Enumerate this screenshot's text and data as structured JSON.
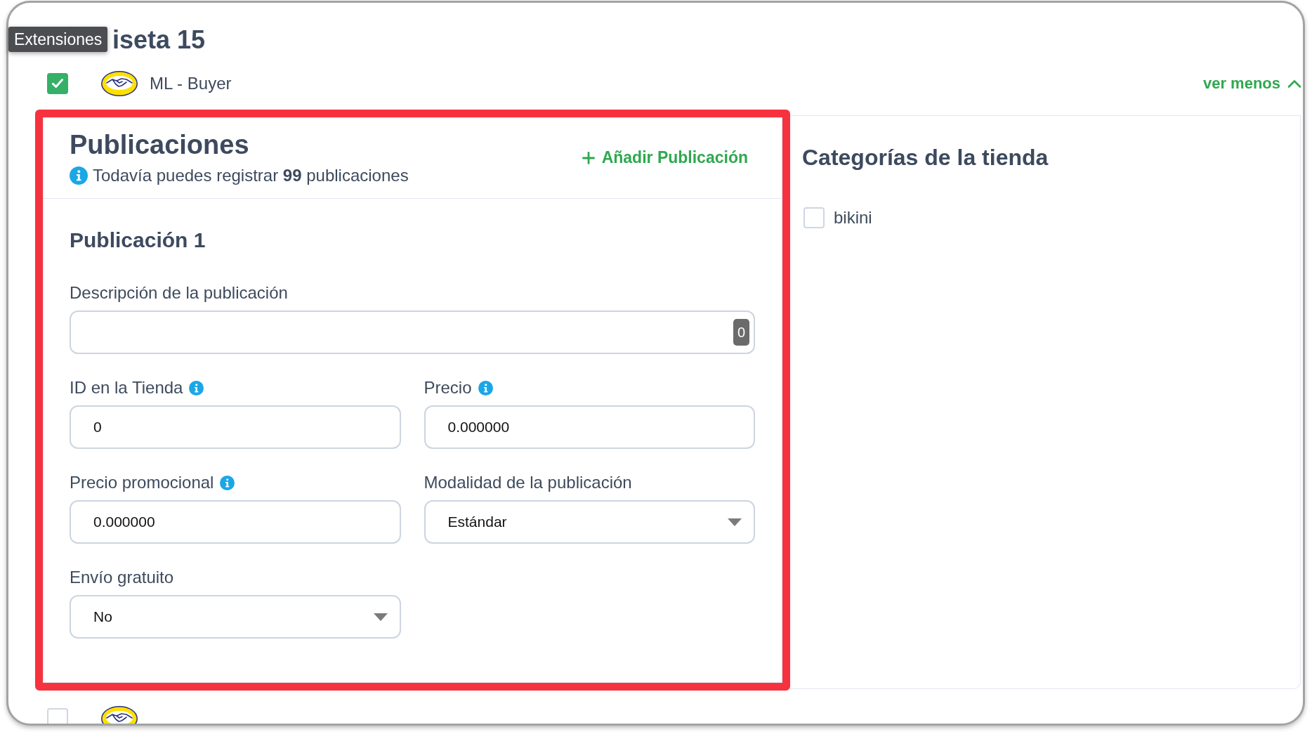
{
  "tooltip": {
    "text": "Extensiones"
  },
  "header": {
    "title": "iseta 15"
  },
  "extensions": [
    {
      "name": "ML - Buyer",
      "checked": true,
      "toggle": {
        "label": "ver menos",
        "expanded": true
      }
    },
    {
      "checked": false
    }
  ],
  "publications_panel": {
    "highlighted": true,
    "title": "Publicaciones",
    "info": "Todavía puedes registrar **99** publicaciones",
    "add_button": "Añadir Publicación",
    "publication": {
      "title": "Publicación 1",
      "fields": [
        {
          "kind": "counter_text",
          "label": "Descripción de la publicación",
          "info": false,
          "counter": "0"
        },
        {
          "kind": "text",
          "label": "ID en la Tienda",
          "info": true,
          "value": "0"
        },
        {
          "kind": "text",
          "label": "Precio",
          "info": true,
          "value": "0.000000"
        },
        {
          "kind": "text",
          "label": "Precio promocional",
          "info": true,
          "value": "0.000000"
        },
        {
          "kind": "select",
          "label": "Modalidad de la publicación",
          "info": false,
          "value": "Estándar"
        },
        {
          "kind": "select",
          "label": "Envío gratuito",
          "info": false,
          "value": "No"
        }
      ]
    }
  },
  "categories_panel": {
    "title": "Categorías de la tienda",
    "items": [
      {
        "label": "bikini",
        "checked": false
      }
    ]
  }
}
